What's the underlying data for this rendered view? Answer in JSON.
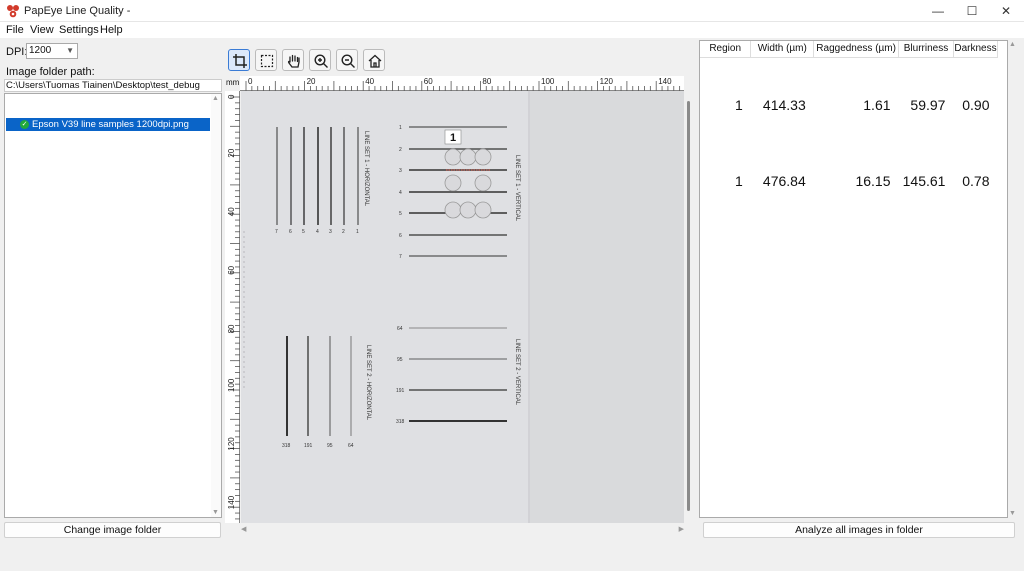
{
  "window": {
    "title": "PapEye Line Quality -",
    "minimize": "—",
    "maximize": "☐",
    "close": "✕"
  },
  "menu": {
    "file": "File",
    "view": "View",
    "settings": "Settings",
    "help": "Help"
  },
  "left_panel": {
    "dpi_label": "DPI:",
    "dpi_value": "1200",
    "folder_label": "Image folder path:",
    "folder_path": "C:\\Users\\Tuomas Tiainen\\Desktop\\test_debug",
    "files": [
      "Epson V39 line samples 1200dpi.png"
    ],
    "change_button": "Change image folder"
  },
  "toolbar": {
    "tools": [
      "crop-tool",
      "rect-select-tool",
      "pan-tool",
      "zoom-in-tool",
      "zoom-out-tool",
      "home-tool"
    ],
    "active": "crop-tool"
  },
  "ruler": {
    "unit": "mm",
    "top_ticks": [
      "0",
      "20",
      "40",
      "60",
      "80",
      "100",
      "120",
      "140"
    ],
    "left_ticks": [
      "0",
      "20",
      "40",
      "60",
      "80",
      "100",
      "120",
      "140"
    ]
  },
  "scan_image": {
    "region_label": "1",
    "set1_horizontal": "LINE SET 1 - HORIZONTAL",
    "set1_vertical": "LINE SET 1 - VERTICAL",
    "set2_horizontal": "LINE SET 2 - HORIZONTAL",
    "set2_vertical": "LINE SET 2 - VERTICAL",
    "set1_h_numbers": [
      "7",
      "6",
      "5",
      "4",
      "3",
      "2",
      "1"
    ],
    "set1_v_numbers": [
      "1",
      "2",
      "3",
      "4",
      "5",
      "6",
      "7"
    ],
    "set2_h_numbers": [
      "318",
      "191",
      "95",
      "64"
    ],
    "set2_v_numbers": [
      "64",
      "95",
      "191",
      "318"
    ]
  },
  "results": {
    "columns": [
      "Region",
      "Width (µm)",
      "Raggedness (µm)",
      "Blurriness",
      "Darkness"
    ],
    "rows": [
      [
        "1",
        "414.33",
        "1.61",
        "59.97",
        "0.90"
      ],
      [
        "1",
        "476.84",
        "16.15",
        "145.61",
        "0.78"
      ]
    ],
    "analyze_button": "Analyze all images in folder"
  },
  "colors": {
    "selection": "#0a64c8",
    "check": "#21a83a",
    "accent": "#3a7bd5",
    "app_icon": "#d23a2a"
  }
}
